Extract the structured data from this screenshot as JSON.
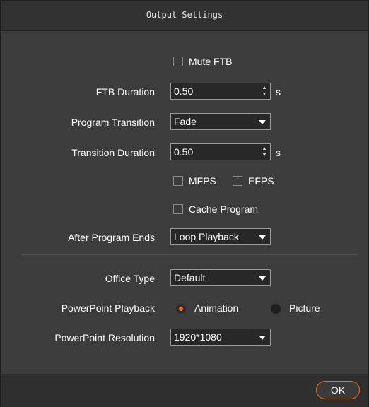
{
  "window": {
    "title": "Output Settings"
  },
  "mute_ftb": {
    "label": "Mute FTB",
    "checked": false
  },
  "ftb_duration": {
    "label": "FTB Duration",
    "value": "0.50",
    "unit": "s"
  },
  "program_transition": {
    "label": "Program Transition",
    "value": "Fade"
  },
  "transition_duration": {
    "label": "Transition Duration",
    "value": "0.50",
    "unit": "s"
  },
  "mfps": {
    "label": "MFPS",
    "checked": false
  },
  "efps": {
    "label": "EFPS",
    "checked": false
  },
  "cache_program": {
    "label": "Cache Program",
    "checked": false
  },
  "after_program_ends": {
    "label": "After Program Ends",
    "value": "Loop Playback"
  },
  "office_type": {
    "label": "Office Type",
    "value": "Default"
  },
  "powerpoint_playback": {
    "label": "PowerPoint Playback",
    "options": [
      {
        "label": "Animation",
        "selected": true
      },
      {
        "label": "Picture",
        "selected": false
      }
    ]
  },
  "powerpoint_resolution": {
    "label": "PowerPoint Resolution",
    "value": "1920*1080"
  },
  "footer": {
    "ok_label": "OK"
  },
  "colors": {
    "accent": "#ff6a1f",
    "background": "#3c3c3c",
    "field": "#282828"
  },
  "icons": {
    "spin": "up-down-arrows",
    "dropdown": "chevron-down"
  }
}
